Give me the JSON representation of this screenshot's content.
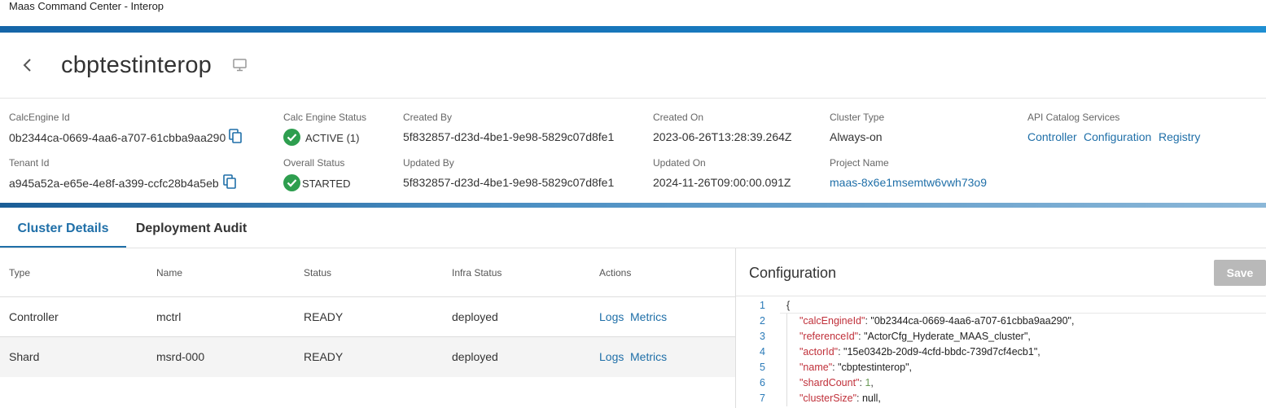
{
  "app_title": "Maas Command Center - Interop",
  "page_title": "cbptestinterop",
  "meta": {
    "calc_engine_id": {
      "label": "CalcEngine Id",
      "value": "0b2344ca-0669-4aa6-a707-61cbba9aa290"
    },
    "tenant_id": {
      "label": "Tenant Id",
      "value": "a945a52a-e65e-4e8f-a399-ccfc28b4a5eb"
    },
    "calc_engine_status": {
      "label": "Calc Engine Status",
      "value": "ACTIVE (1)"
    },
    "overall_status": {
      "label": "Overall Status",
      "value": "STARTED"
    },
    "created_by": {
      "label": "Created By",
      "value": "5f832857-d23d-4be1-9e98-5829c07d8fe1"
    },
    "updated_by": {
      "label": "Updated By",
      "value": "5f832857-d23d-4be1-9e98-5829c07d8fe1"
    },
    "created_on": {
      "label": "Created On",
      "value": "2023-06-26T13:28:39.264Z"
    },
    "updated_on": {
      "label": "Updated On",
      "value": "2024-11-26T09:00:00.091Z"
    },
    "cluster_type": {
      "label": "Cluster Type",
      "value": "Always-on"
    },
    "project_name": {
      "label": "Project Name",
      "value": "maas-8x6e1msemtw6vwh73o9"
    },
    "api_catalog": {
      "label": "API Catalog Services",
      "links": [
        "Controller",
        "Configuration",
        "Registry"
      ]
    }
  },
  "tabs": [
    {
      "label": "Cluster Details",
      "active": true
    },
    {
      "label": "Deployment Audit",
      "active": false
    }
  ],
  "table": {
    "headers": [
      "Type",
      "Name",
      "Status",
      "Infra Status",
      "Actions"
    ],
    "rows": [
      {
        "type": "Controller",
        "name": "mctrl",
        "status": "READY",
        "infra_status": "deployed",
        "actions": [
          "Logs",
          "Metrics"
        ]
      },
      {
        "type": "Shard",
        "name": "msrd-000",
        "status": "READY",
        "infra_status": "deployed",
        "actions": [
          "Logs",
          "Metrics"
        ]
      }
    ]
  },
  "config": {
    "title": "Configuration",
    "save_label": "Save",
    "lines": [
      {
        "n": "1",
        "text": "{"
      },
      {
        "n": "2",
        "key": "\"calcEngineId\"",
        "val": "\"0b2344ca-0669-4aa6-a707-61cbba9aa290\","
      },
      {
        "n": "3",
        "key": "\"referenceId\"",
        "val": "\"ActorCfg_Hyderate_MAAS_cluster\","
      },
      {
        "n": "4",
        "key": "\"actorId\"",
        "val": "\"15e0342b-20d9-4cfd-bbdc-739d7cf4ecb1\","
      },
      {
        "n": "5",
        "key": "\"name\"",
        "val": "\"cbptestinterop\","
      },
      {
        "n": "6",
        "key": "\"shardCount\"",
        "num": "1",
        "tail": ","
      },
      {
        "n": "7",
        "key": "\"clusterSize\"",
        "val": "null,"
      }
    ]
  },
  "colors": {
    "accent": "#1f6fa8",
    "success": "#2e9e4f",
    "key": "#c0303a"
  },
  "icons": [
    "back-chevron-icon",
    "monitor-icon",
    "copy-icon",
    "check-circle-icon"
  ]
}
